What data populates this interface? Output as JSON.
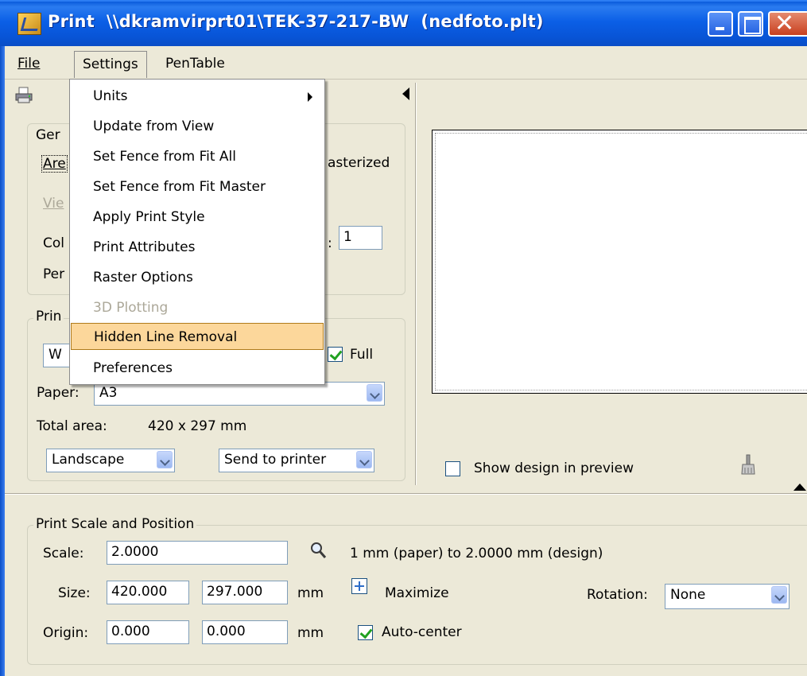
{
  "window": {
    "title": "Print  \\\\dkramvirprt01\\TEK-37-217-BW  (nedfoto.plt)"
  },
  "menubar": {
    "file": "File",
    "settings": "Settings",
    "pentable": "PenTable"
  },
  "settings_menu": {
    "items": [
      {
        "label": "Units",
        "has_submenu": true,
        "enabled": true
      },
      {
        "label": "Update from View",
        "enabled": true
      },
      {
        "label": "Set Fence from Fit All",
        "enabled": true
      },
      {
        "label": "Set Fence from Fit Master",
        "enabled": true
      },
      {
        "label": "Apply Print Style",
        "enabled": true
      },
      {
        "label": "Print Attributes",
        "enabled": true
      },
      {
        "label": "Raster Options",
        "enabled": true
      },
      {
        "label": "3D Plotting",
        "enabled": false
      },
      {
        "label": "Hidden Line Removal",
        "enabled": true,
        "highlighted": true
      },
      {
        "label": "Preferences",
        "enabled": true
      }
    ]
  },
  "general": {
    "title_fragment": "Ger",
    "area_fragment": "Are",
    "view_fragment": "Vie",
    "color_fragment": "Col",
    "pen_fragment": "Per",
    "rasterized_fragment": "asterized",
    "copies_colon": ":",
    "copies_value": "1"
  },
  "printer": {
    "title_fragment": "Prin",
    "combo_fragment": "W",
    "full_label": "Full",
    "full_checked": true,
    "paper_label": "Paper:",
    "paper_value": "A3",
    "total_area_label": "Total area:",
    "total_area_value": "420 x 297 mm",
    "orientation": "Landscape",
    "destination": "Send to printer"
  },
  "preview": {
    "show_design_label": "Show design in preview",
    "show_design_checked": false
  },
  "scale_position": {
    "title": "Print Scale and Position",
    "scale_label": "Scale:",
    "scale_value": "2.0000",
    "scale_description": "1 mm (paper) to 2.0000 mm (design)",
    "size_label": "Size:",
    "size_width": "420.000",
    "size_height": "297.000",
    "size_unit": "mm",
    "maximize_label": "Maximize",
    "rotation_label": "Rotation:",
    "rotation_value": "None",
    "origin_label": "Origin:",
    "origin_x": "0.000",
    "origin_y": "0.000",
    "origin_unit": "mm",
    "autocenter_label": "Auto-center",
    "autocenter_checked": true
  },
  "colors": {
    "titlebar": "#0a5bdc",
    "menu_highlight": "#fcd79b",
    "dialog_bg": "#ece9d8"
  }
}
